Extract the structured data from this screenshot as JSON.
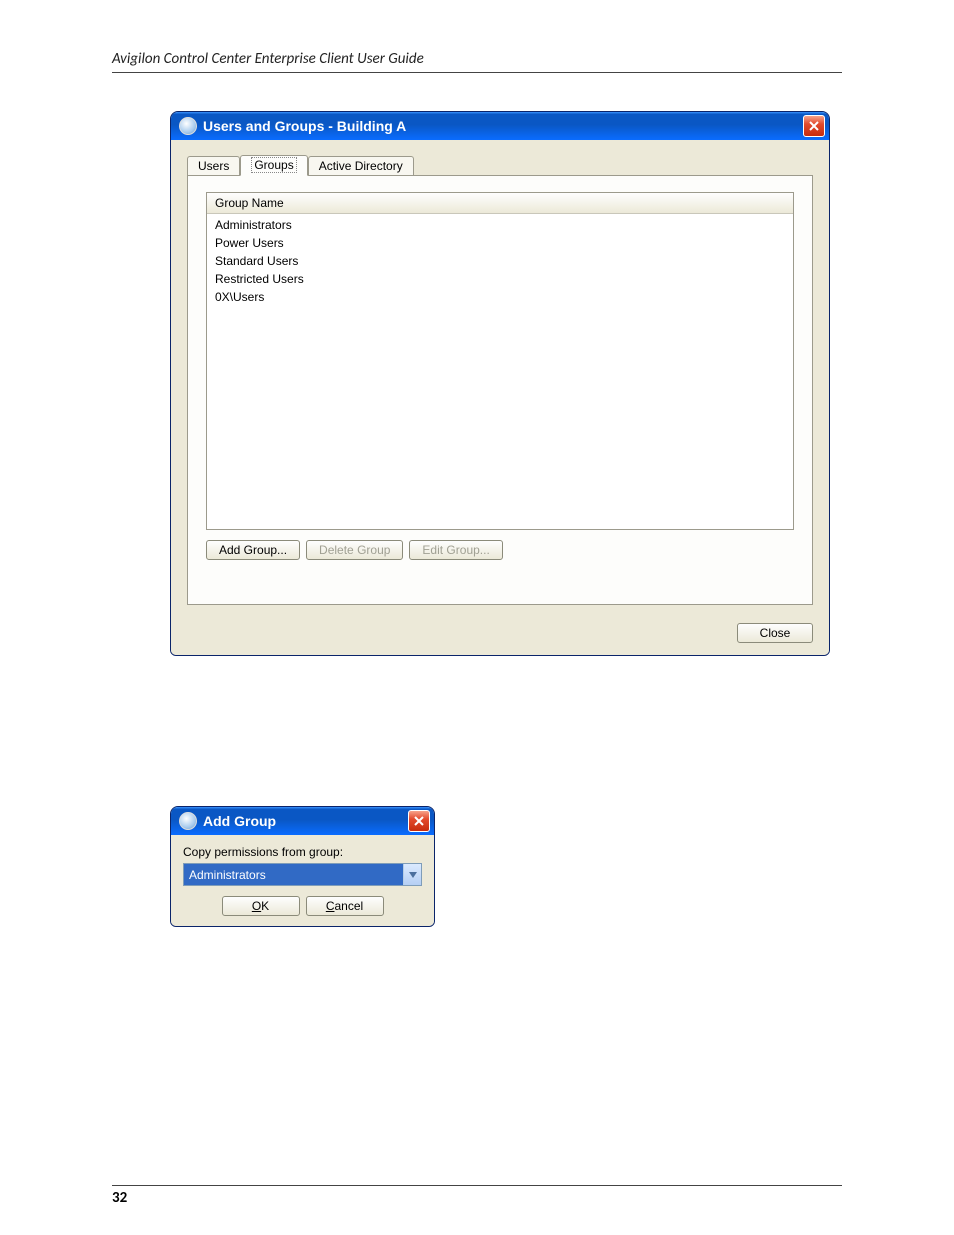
{
  "doc": {
    "header": "Avigilon Control Center Enterprise Client User Guide",
    "page_number": "32"
  },
  "window1": {
    "title": "Users and Groups - Building A",
    "tabs": [
      "Users",
      "Groups",
      "Active Directory"
    ],
    "active_tab_index": 1,
    "list_header": "Group Name",
    "groups": [
      "Administrators",
      "Power Users",
      "Standard Users",
      "Restricted Users",
      "0X\\Users"
    ],
    "buttons": {
      "add": "Add Group...",
      "delete": "Delete Group",
      "edit": "Edit Group..."
    },
    "close_label": "Close"
  },
  "window2": {
    "title": "Add Group",
    "label": "Copy permissions from group:",
    "selected": "Administrators",
    "ok": "OK",
    "cancel": "Cancel"
  }
}
